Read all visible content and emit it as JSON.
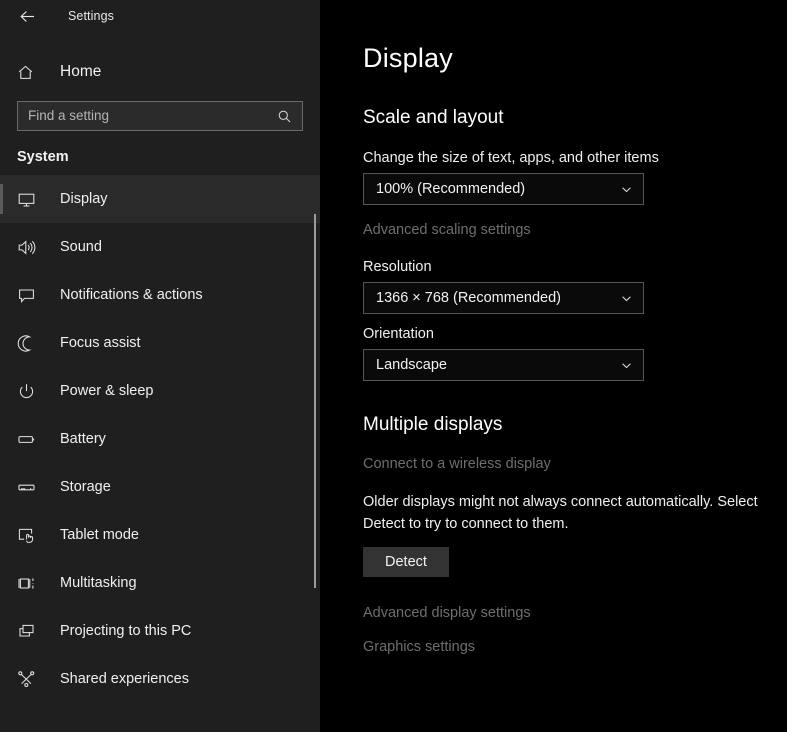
{
  "window": {
    "app_title": "Settings",
    "back_icon": "back-arrow-icon"
  },
  "sidebar": {
    "home": {
      "label": "Home",
      "icon": "home-icon"
    },
    "search": {
      "placeholder": "Find a setting",
      "value": "",
      "icon": "search-icon"
    },
    "group_title": "System",
    "selected_item": "Display",
    "items": [
      {
        "label": "Display",
        "icon": "monitor-icon",
        "selected": true
      },
      {
        "label": "Sound",
        "icon": "speaker-icon",
        "selected": false
      },
      {
        "label": "Notifications & actions",
        "icon": "chat-bubble-icon",
        "selected": false
      },
      {
        "label": "Focus assist",
        "icon": "moon-icon",
        "selected": false
      },
      {
        "label": "Power & sleep",
        "icon": "power-icon",
        "selected": false
      },
      {
        "label": "Battery",
        "icon": "battery-icon",
        "selected": false
      },
      {
        "label": "Storage",
        "icon": "drive-icon",
        "selected": false
      },
      {
        "label": "Tablet mode",
        "icon": "tablet-touch-icon",
        "selected": false
      },
      {
        "label": "Multitasking",
        "icon": "multitasking-icon",
        "selected": false
      },
      {
        "label": "Projecting to this PC",
        "icon": "projecting-icon",
        "selected": false
      },
      {
        "label": "Shared experiences",
        "icon": "share-nodes-icon",
        "selected": false
      }
    ],
    "scrollbar": {
      "name": "sidebar-scrollbar"
    }
  },
  "main": {
    "page_title": "Display",
    "scale_section": {
      "heading": "Scale and layout",
      "scale_label": "Change the size of text, apps, and other items",
      "scale_value": "100% (Recommended)",
      "advanced_scaling_link": "Advanced scaling settings",
      "resolution_label": "Resolution",
      "resolution_value": "1366 × 768 (Recommended)",
      "orientation_label": "Orientation",
      "orientation_value": "Landscape"
    },
    "multiple_displays_section": {
      "heading": "Multiple displays",
      "wireless_link": "Connect to a wireless display",
      "description": "Older displays might not always connect automatically. Select Detect to try to connect to them.",
      "detect_button": "Detect",
      "advanced_display_link": "Advanced display settings",
      "graphics_link": "Graphics settings"
    }
  },
  "colors": {
    "sidebar_bg": "#1f1f1f",
    "main_bg": "#000000",
    "text_primary": "#f0f0f0",
    "text_dim": "#6e6e6e",
    "selected_row_bg": "#2a2a2a",
    "selection_bar": "#5a5a5a",
    "button_bg": "#333333",
    "combo_border": "#555555",
    "search_border": "#6b6b6b"
  }
}
